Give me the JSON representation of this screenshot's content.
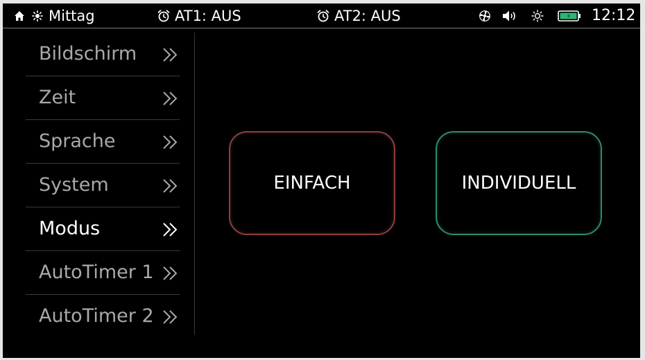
{
  "statusbar": {
    "mode_label": "Mittag",
    "at1_label": "AT1: AUS",
    "at2_label": "AT2: AUS",
    "clock": "12:12",
    "icons": [
      "home-icon",
      "sun-icon",
      "alarm-clock-icon",
      "fan-icon",
      "speaker-icon",
      "brightness-icon",
      "battery-icon"
    ],
    "battery_color": "#2bb673"
  },
  "menu": {
    "items": [
      {
        "label": "Bildschirm",
        "active": false
      },
      {
        "label": "Zeit",
        "active": false
      },
      {
        "label": "Sprache",
        "active": false
      },
      {
        "label": "System",
        "active": false
      },
      {
        "label": "Modus",
        "active": true
      },
      {
        "label": "AutoTimer 1",
        "active": false
      },
      {
        "label": "AutoTimer 2",
        "active": false
      }
    ]
  },
  "modes": {
    "einfach_label": "EINFACH",
    "individuell_label": "INDIVIDUELL",
    "einfach_border_color": "#8c3f3f",
    "individuell_border_color": "#2f8a73"
  }
}
